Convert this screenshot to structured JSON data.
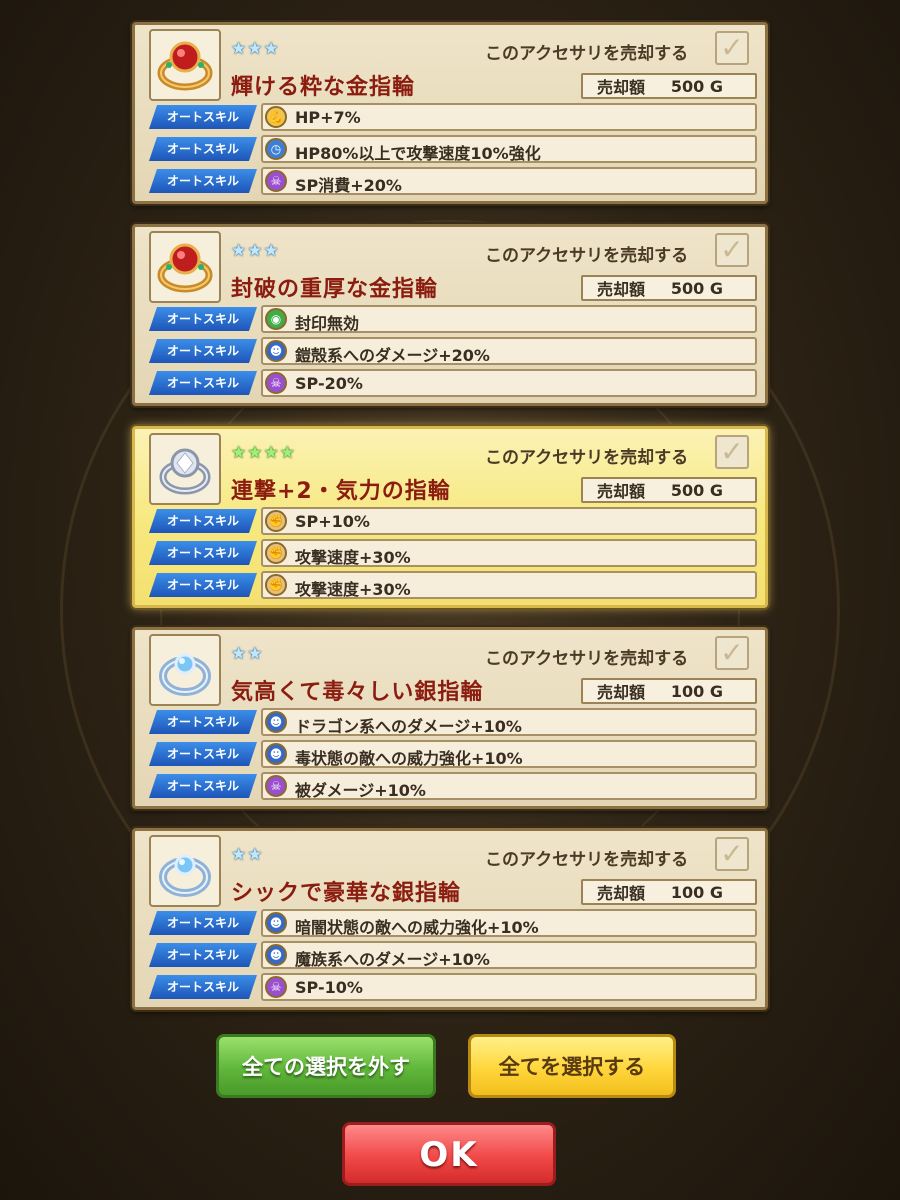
{
  "labels": {
    "sell_checkbox": "このアクセサリを売却する",
    "price_label": "売却額",
    "auto_skill": "オートスキル"
  },
  "items": [
    {
      "stars": "★★★",
      "name": "輝ける粋な金指輪",
      "price": "500 G",
      "selected": false,
      "ring": "gold-red",
      "skills": [
        {
          "icon": "muscle-icon",
          "text": "HP+7%"
        },
        {
          "icon": "clock-icon",
          "text": "HP80%以上で攻撃速度10%強化"
        },
        {
          "icon": "skull-icon",
          "text": "SP消費+20%"
        }
      ]
    },
    {
      "stars": "★★★",
      "name": "封破の重厚な金指輪",
      "price": "500 G",
      "selected": false,
      "ring": "gold-red",
      "skills": [
        {
          "icon": "seal-icon",
          "text": "封印無効"
        },
        {
          "icon": "demon-icon",
          "text": "鎧殻系へのダメージ+20%"
        },
        {
          "icon": "skull-icon",
          "text": "SP-20%"
        }
      ]
    },
    {
      "stars": "★★★★",
      "name": "連撃+2・気力の指輪",
      "price": "500 G",
      "selected": true,
      "ring": "silver-diamond",
      "skills": [
        {
          "icon": "fist-icon",
          "text": "SP+10%"
        },
        {
          "icon": "fist-icon",
          "text": "攻撃速度+30%"
        },
        {
          "icon": "fist-icon",
          "text": "攻撃速度+30%"
        }
      ]
    },
    {
      "stars": "★★",
      "name": "気高くて毒々しい銀指輪",
      "price": "100 G",
      "selected": false,
      "ring": "silver-blue",
      "skills": [
        {
          "icon": "demon-icon",
          "text": "ドラゴン系へのダメージ+10%"
        },
        {
          "icon": "demon-icon",
          "text": "毒状態の敵への威力強化+10%"
        },
        {
          "icon": "skull-icon",
          "text": "被ダメージ+10%"
        }
      ]
    },
    {
      "stars": "★★",
      "name": "シックで豪華な銀指輪",
      "price": "100 G",
      "selected": false,
      "ring": "silver-blue",
      "skills": [
        {
          "icon": "demon-icon",
          "text": "暗闇状態の敵への威力強化+10%"
        },
        {
          "icon": "demon-icon",
          "text": "魔族系へのダメージ+10%"
        },
        {
          "icon": "skull-icon",
          "text": "SP-10%"
        }
      ]
    }
  ],
  "buttons": {
    "deselect_all": "全ての選択を外す",
    "select_all": "全てを選択する",
    "ok": "OK"
  },
  "colors": {
    "item_name": "#8b1c10",
    "skill_badge": "#1d55b8",
    "selected_card": "#f7e87e"
  }
}
